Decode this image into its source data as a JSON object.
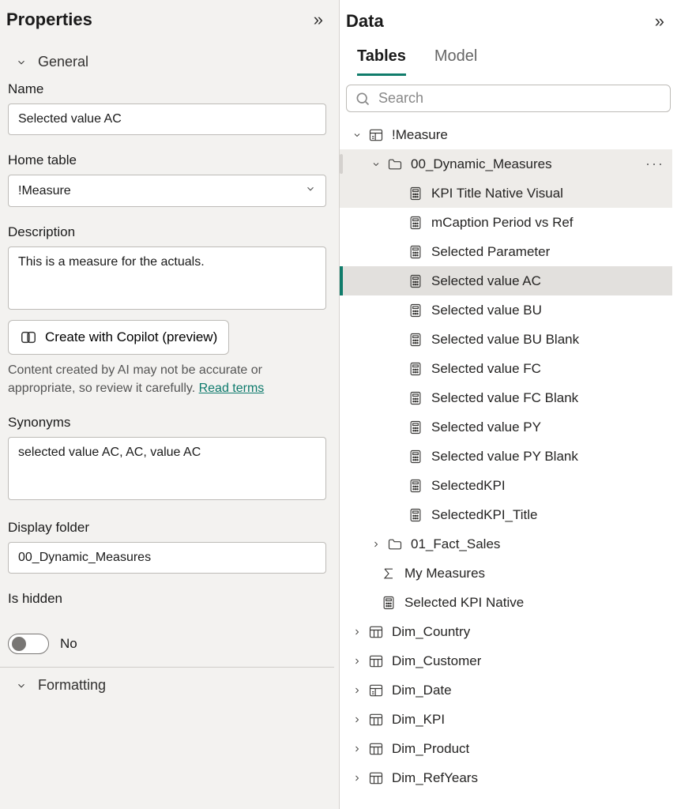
{
  "properties": {
    "title": "Properties",
    "sections": {
      "general": "General",
      "formatting": "Formatting"
    },
    "fields": {
      "name_label": "Name",
      "name_value": "Selected value AC",
      "home_table_label": "Home table",
      "home_table_value": "!Measure",
      "description_label": "Description",
      "description_value": "This is a measure for the actuals.",
      "copilot_button": "Create with Copilot (preview)",
      "ai_note_text": "Content created by AI may not be accurate or appropriate, so review it carefully. ",
      "ai_note_link": "Read terms",
      "synonyms_label": "Synonyms",
      "synonyms_value": "selected value AC, AC, value AC",
      "display_folder_label": "Display folder",
      "display_folder_value": "00_Dynamic_Measures",
      "is_hidden_label": "Is hidden",
      "is_hidden_value": "No"
    }
  },
  "data": {
    "title": "Data",
    "tabs": {
      "tables": "Tables",
      "model": "Model"
    },
    "search_placeholder": "Search",
    "tree": {
      "measure_table": "!Measure",
      "folder_dynamic": "00_Dynamic_Measures",
      "measures": [
        "KPI Title Native Visual",
        "mCaption Period vs Ref",
        "Selected Parameter",
        "Selected value AC",
        "Selected value BU",
        "Selected value BU Blank",
        "Selected value FC",
        "Selected value FC Blank",
        "Selected value PY",
        "Selected value PY Blank",
        "SelectedKPI",
        "SelectedKPI_Title"
      ],
      "folder_fact": "01_Fact_Sales",
      "my_measures": "My Measures",
      "selected_kpi_native": "Selected KPI Native",
      "dims": [
        "Dim_Country",
        "Dim_Customer",
        "Dim_Date",
        "Dim_KPI",
        "Dim_Product",
        "Dim_RefYears"
      ]
    }
  }
}
